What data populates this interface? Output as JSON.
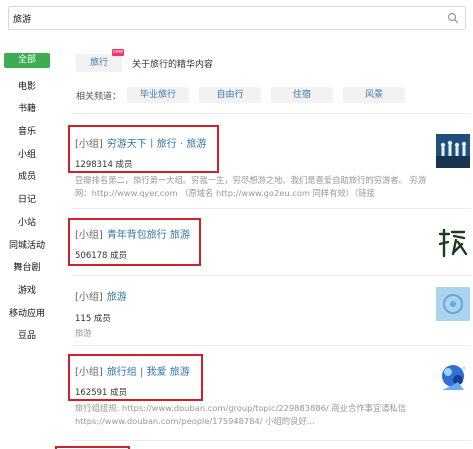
{
  "search": {
    "value": "旅游",
    "placeholder": ""
  },
  "nav": [
    {
      "label": "全部",
      "active": true
    },
    {
      "label": "电影"
    },
    {
      "label": "书籍"
    },
    {
      "label": "音乐"
    },
    {
      "label": "小组"
    },
    {
      "label": "成员"
    },
    {
      "label": "日记"
    },
    {
      "label": "小站"
    },
    {
      "label": "同城活动"
    },
    {
      "label": "舞台剧"
    },
    {
      "label": "游戏"
    },
    {
      "label": "移动应用"
    },
    {
      "label": "豆品"
    }
  ],
  "tag": {
    "label": "旅行",
    "badge": "new",
    "desc": "关于旅行的精华内容"
  },
  "related": {
    "label": "相关频道：",
    "chips": [
      "毕业旅行",
      "自由行",
      "住宿",
      "风景"
    ]
  },
  "results": [
    {
      "kind": "[小组]",
      "title": "穷游天下丨旅行 · 旅游",
      "meta": "1298314 成员",
      "desc": "豆瓣排名第二，旅行第一大组。穷我一生，穷尽想游之地。我们是喜爱自助旅行的穷游者。 穷游网：http://www.qyer.com （原域名 http://www.go2eu.com 同样有效）（链接",
      "thumb": "crowd-photo"
    },
    {
      "kind": "[小组]",
      "title": "青年背包旅行 旅游",
      "meta": "506178 成员",
      "desc": "",
      "thumb": "calligraphy-lv"
    },
    {
      "kind": "[小组]",
      "title": "旅游",
      "meta": "115 成员",
      "desc": "旅游",
      "thumb": "blue-badge"
    },
    {
      "kind": "[小组]",
      "title": "旅行组 | 我爱 旅游",
      "meta": "162591 成员",
      "desc": "旅行组组规: https://www.douban.com/group/topic/229883886/ 商业合作事宜请私信 https://www.douban.com/people/175948784/ 小组的良好...",
      "thumb": "blue-art"
    }
  ],
  "colors": {
    "accent": "#3dac51",
    "link": "#3377aa",
    "highlight": "#d0202a"
  }
}
